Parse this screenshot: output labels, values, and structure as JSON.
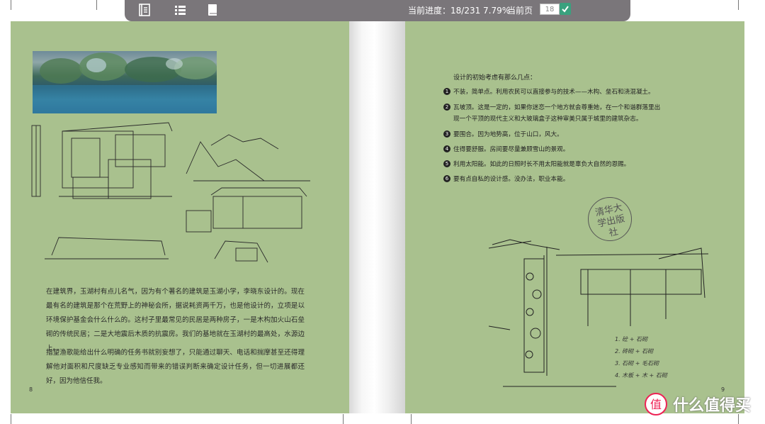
{
  "toolbar": {
    "icons": [
      "table-of-contents-icon",
      "list-icon",
      "book-icon"
    ],
    "progress_text": "当前进度：18/231 7.79%",
    "page_label": "当前页",
    "page_value": "18",
    "confirm_icon": "checkmark-icon"
  },
  "left_page": {
    "number": "8",
    "paragraph_1": "在建筑界，玉湖村有点儿名气，因为有个著名的建筑是玉湖小学，李晓东设计的。现在最有名的建筑是那个在荒野上的神秘会所，据说耗资两千万，也是他设计的，立项是以环境保护基金会什么什么的。这村子里最常见的民居是两种房子，一是木构加火山石垒砌的传统民居；二是大地震后木质的抗震房。我们的基地就在玉湖村的最高处，水源边上。",
    "paragraph_2": "指望渔歌能给出什么明确的任务书就别妄想了，只能通过聊天、电话和揣摩甚至还得理解他对面积和尺度缺乏专业感知而带来的错误判断来确定设计任务，但一切进展都还好，因为他信任我。"
  },
  "right_page": {
    "number": "9",
    "intro": "设计的初始考虑有那么几点：",
    "items": [
      {
        "bullet": "1",
        "text": "不装，简单点。利用农民可以直接参与的技术——木构、垒石和浇混凝土。"
      },
      {
        "bullet": "2",
        "text": "瓦坡顶。这是一定的，如果你迷恋一个地方就会尊重她，在一个和谐群落里出现一个平顶的现代主义和大玻璃盒子这种审美只属于城里的建筑杂志。"
      },
      {
        "bullet": "3",
        "text": "要围合。因为地势高，位于山口，风大。"
      },
      {
        "bullet": "4",
        "text": "住得要舒服。房间要尽量兼顾雪山的景观。"
      },
      {
        "bullet": "5",
        "text": "利用太阳能。如此的日照时长不用太阳能就是辜负大自然的恩赐。"
      },
      {
        "bullet": "6",
        "text": "要有点自私的设计感。没办法，职业本能。"
      }
    ],
    "stamp": "清华大学出版社"
  },
  "watermark": {
    "text": "什么值得买",
    "icon": "smzdm-logo-icon"
  },
  "colors": {
    "page_bg": "#a9c18e",
    "toolbar_bg": "#7a767a",
    "confirm_green": "#3aa17e"
  }
}
